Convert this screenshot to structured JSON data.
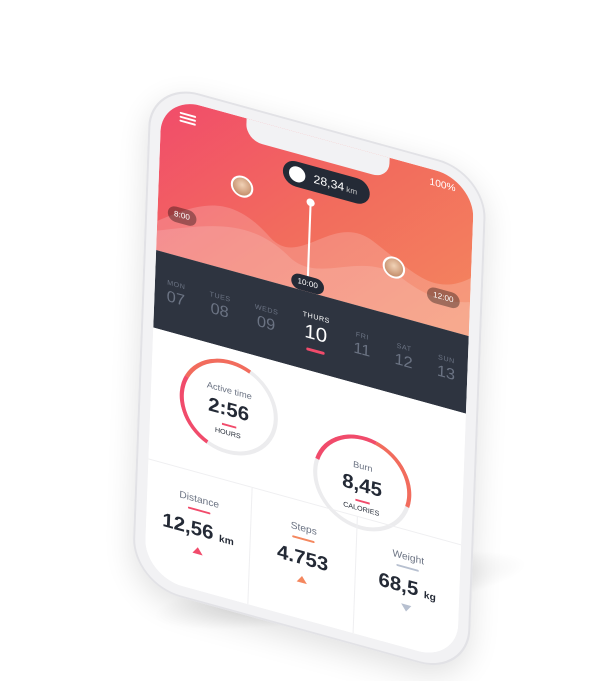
{
  "status": {
    "battery": "100%"
  },
  "header": {
    "distance_value": "28,34",
    "distance_unit": "km",
    "time_left": "8:00",
    "time_center": "10:00",
    "time_right": "12:00"
  },
  "days": [
    {
      "name": "Mon",
      "num": "07"
    },
    {
      "name": "Tues",
      "num": "08"
    },
    {
      "name": "Weds",
      "num": "09"
    },
    {
      "name": "Thurs",
      "num": "10"
    },
    {
      "name": "Fri",
      "num": "11"
    },
    {
      "name": "Sat",
      "num": "12"
    },
    {
      "name": "Sun",
      "num": "13"
    }
  ],
  "rings": {
    "active": {
      "label": "Active time",
      "value": "2:56",
      "unit": "Hours"
    },
    "burn": {
      "label": "Burn",
      "value": "8,45",
      "unit": "Calories"
    }
  },
  "stats": {
    "distance": {
      "label": "Distance",
      "value": "12,56",
      "unit": "km"
    },
    "steps": {
      "label": "Steps",
      "value": "4.753"
    },
    "weight": {
      "label": "Weight",
      "value": "68,5",
      "unit": "kg"
    }
  },
  "colors": {
    "accent_pink": "#f14b6b",
    "accent_orange": "#f4875e",
    "dark": "#2e3440"
  }
}
